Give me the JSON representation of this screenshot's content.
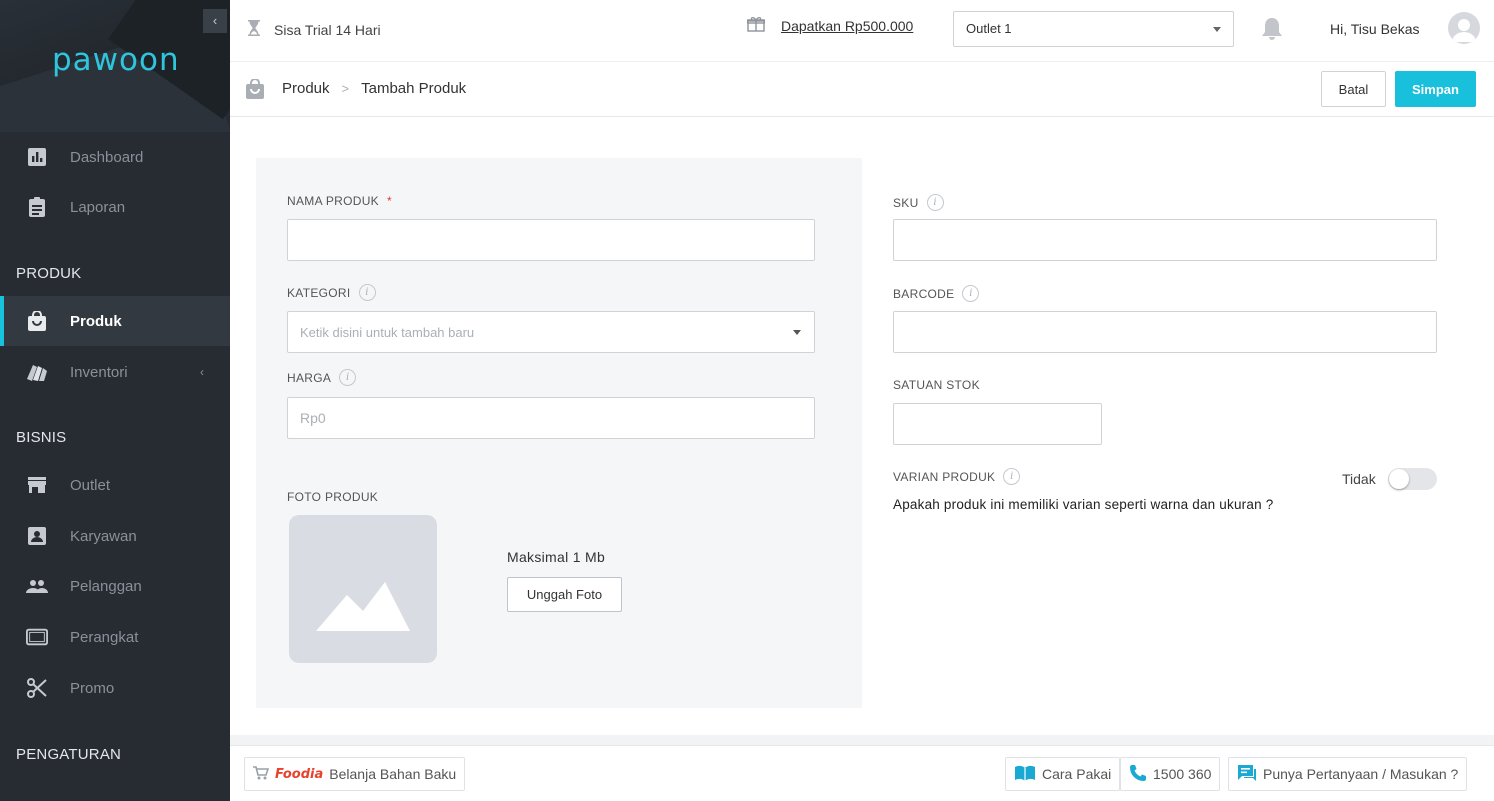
{
  "sidebar": {
    "brand": "pawoon",
    "collapse_icon": "‹",
    "items": [
      {
        "label": "Dashboard"
      },
      {
        "label": "Laporan"
      },
      {
        "label": "Produk"
      },
      {
        "label": "Inventori"
      },
      {
        "label": "Outlet"
      },
      {
        "label": "Karyawan"
      },
      {
        "label": "Pelanggan"
      },
      {
        "label": "Perangkat"
      },
      {
        "label": "Promo"
      }
    ],
    "sections": [
      "PRODUK",
      "BISNIS",
      "PENGATURAN"
    ],
    "accent_color": "#18c2dc"
  },
  "topbar": {
    "trial": "Sisa Trial 14 Hari",
    "promo": "Dapatkan Rp500.000",
    "outlet": "Outlet 1",
    "greeting": "Hi, Tisu Bekas"
  },
  "breadcrumb": {
    "items": [
      "Produk",
      "Tambah Produk"
    ],
    "separator": ">"
  },
  "actions": {
    "cancel": "Batal",
    "save": "Simpan"
  },
  "form": {
    "nama_produk": {
      "label": "NAMA PRODUK",
      "required": "*",
      "value": ""
    },
    "kategori": {
      "label": "KATEGORI",
      "placeholder": "Ketik disini untuk tambah baru"
    },
    "harga": {
      "label": "HARGA",
      "placeholder": "Rp0"
    },
    "foto": {
      "label": "FOTO PRODUK",
      "max_size": "Maksimal 1 Mb",
      "upload": "Unggah Foto"
    },
    "sku": {
      "label": "SKU",
      "value": ""
    },
    "barcode": {
      "label": "BARCODE",
      "value": ""
    },
    "satuan_stok": {
      "label": "SATUAN STOK",
      "value": ""
    },
    "varian": {
      "label": "VARIAN PRODUK",
      "question": "Apakah produk ini memiliki varian seperti warna dan ukuran ?",
      "toggle_label": "Tidak",
      "toggle_on": false
    },
    "info_icon": "i"
  },
  "footer": {
    "foodia_brand": "Foodia",
    "shop": "Belanja Bahan Baku",
    "guide": "Cara Pakai",
    "phone": "1500 360",
    "feedback": "Punya Pertanyaan / Masukan ?"
  }
}
